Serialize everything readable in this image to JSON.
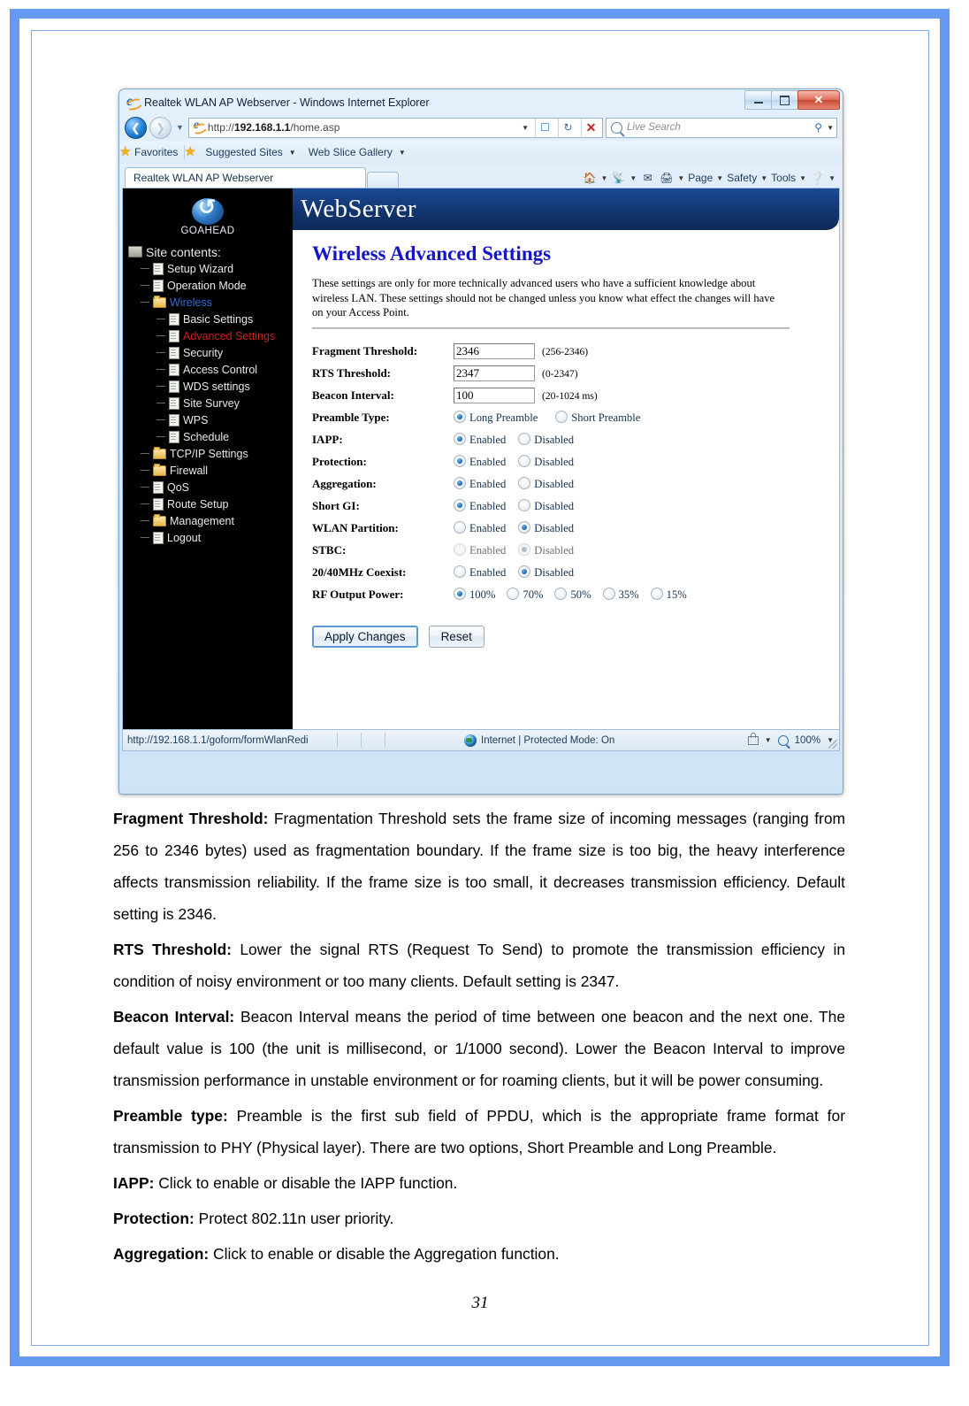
{
  "browser": {
    "window_title": "Realtek WLAN AP Webserver - Windows Internet Explorer",
    "window_buttons": {
      "minimize": "minimize-button",
      "maximize": "maximize-button",
      "close": "✕"
    },
    "address": {
      "url_prefix": "http://",
      "url_host": "192.168.1.1",
      "url_path": "/home.asp"
    },
    "search_placeholder": "Live Search",
    "favorites_label": "Favorites",
    "suggested_sites_label": "Suggested Sites",
    "web_slice_label": "Web Slice Gallery",
    "tab_label": "Realtek WLAN AP Webserver",
    "command_bar": [
      "Page",
      "Safety",
      "Tools"
    ],
    "status": {
      "url": "http://192.168.1.1/goform/formWlanRedi",
      "zone": "Internet | Protected Mode: On",
      "zoom": "100%"
    }
  },
  "webapp": {
    "brand": "GOAHEAD",
    "banner_title": "WebServer",
    "sidebar": {
      "root_label": "Site contents:",
      "items": [
        {
          "label": "Setup Wizard",
          "icon": "doc-icon",
          "level": 1,
          "state": "normal"
        },
        {
          "label": "Operation Mode",
          "icon": "doc-icon",
          "level": 1,
          "state": "normal"
        },
        {
          "label": "Wireless",
          "icon": "folder-icon",
          "level": 1,
          "state": "open"
        },
        {
          "label": "Basic Settings",
          "icon": "doc-icon",
          "level": 2,
          "state": "normal"
        },
        {
          "label": "Advanced Settings",
          "icon": "doc-icon",
          "level": 2,
          "state": "selected"
        },
        {
          "label": "Security",
          "icon": "doc-icon",
          "level": 2,
          "state": "normal"
        },
        {
          "label": "Access Control",
          "icon": "doc-icon",
          "level": 2,
          "state": "normal"
        },
        {
          "label": "WDS settings",
          "icon": "doc-icon",
          "level": 2,
          "state": "normal"
        },
        {
          "label": "Site Survey",
          "icon": "doc-icon",
          "level": 2,
          "state": "normal"
        },
        {
          "label": "WPS",
          "icon": "doc-icon",
          "level": 2,
          "state": "normal"
        },
        {
          "label": "Schedule",
          "icon": "doc-icon",
          "level": 2,
          "state": "normal"
        },
        {
          "label": "TCP/IP Settings",
          "icon": "folder-icon",
          "level": 1,
          "state": "normal"
        },
        {
          "label": "Firewall",
          "icon": "folder-icon",
          "level": 1,
          "state": "normal"
        },
        {
          "label": "QoS",
          "icon": "doc-icon",
          "level": 1,
          "state": "normal"
        },
        {
          "label": "Route Setup",
          "icon": "doc-icon",
          "level": 1,
          "state": "normal"
        },
        {
          "label": "Management",
          "icon": "folder-icon",
          "level": 1,
          "state": "normal"
        },
        {
          "label": "Logout",
          "icon": "doc-icon",
          "level": 1,
          "state": "normal"
        }
      ]
    },
    "page_title": "Wireless Advanced Settings",
    "page_description": "These settings are only for more technically advanced users who have a sufficient knowledge about wireless LAN. These settings should not be changed unless you know what effect the changes will have on your Access Point.",
    "fields": {
      "fragment_threshold": {
        "label": "Fragment Threshold:",
        "value": "2346",
        "hint": "(256-2346)"
      },
      "rts_threshold": {
        "label": "RTS Threshold:",
        "value": "2347",
        "hint": "(0-2347)"
      },
      "beacon_interval": {
        "label": "Beacon Interval:",
        "value": "100",
        "hint": "(20-1024 ms)"
      },
      "preamble_type": {
        "label": "Preamble Type:",
        "options": [
          "Long Preamble",
          "Short Preamble"
        ],
        "selected": "Long Preamble"
      },
      "iapp": {
        "label": "IAPP:",
        "options": [
          "Enabled",
          "Disabled"
        ],
        "selected": "Enabled"
      },
      "protection": {
        "label": "Protection:",
        "options": [
          "Enabled",
          "Disabled"
        ],
        "selected": "Enabled"
      },
      "aggregation": {
        "label": "Aggregation:",
        "options": [
          "Enabled",
          "Disabled"
        ],
        "selected": "Enabled"
      },
      "short_gi": {
        "label": "Short GI:",
        "options": [
          "Enabled",
          "Disabled"
        ],
        "selected": "Enabled"
      },
      "wlan_partition": {
        "label": "WLAN Partition:",
        "options": [
          "Enabled",
          "Disabled"
        ],
        "selected": "Disabled"
      },
      "stbc": {
        "label": "STBC:",
        "options": [
          "Enabled",
          "Disabled"
        ],
        "selected": "Disabled",
        "disabled": true
      },
      "coexist": {
        "label": "20/40MHz Coexist:",
        "options": [
          "Enabled",
          "Disabled"
        ],
        "selected": "Disabled"
      },
      "rf_output_power": {
        "label": "RF Output Power:",
        "options": [
          "100%",
          "70%",
          "50%",
          "35%",
          "15%"
        ],
        "selected": "100%"
      }
    },
    "buttons": {
      "apply": "Apply Changes",
      "reset": "Reset"
    }
  },
  "manual": {
    "paragraphs": [
      {
        "term": "Fragment Threshold:",
        "text": " Fragmentation Threshold sets the frame size of incoming messages (ranging from 256 to 2346 bytes) used as fragmentation boundary. If the frame size is too big, the heavy interference affects transmission reliability. If the frame size is too small, it decreases transmission efficiency. Default setting is 2346."
      },
      {
        "term": "RTS Threshold:",
        "text": " Lower the signal RTS (Request To Send) to promote the transmission efficiency in condition of noisy environment or too many clients. Default setting is 2347."
      },
      {
        "term": "Beacon Interval:",
        "text": " Beacon Interval means the period of time between one beacon and the next one. The default value is 100 (the unit is millisecond, or 1/1000 second). Lower the Beacon Interval to improve transmission performance in unstable environment or for roaming clients, but it will be power consuming."
      },
      {
        "term": "Preamble type:",
        "text": " Preamble is the first sub field of PPDU, which is the appropriate frame format for transmission to PHY (Physical layer). There are two options, Short Preamble and Long Preamble."
      },
      {
        "term": "IAPP:",
        "text": " Click to enable or disable the IAPP function."
      },
      {
        "term": "Protection:",
        "text": " Protect 802.11n user priority."
      },
      {
        "term": "Aggregation:",
        "text": " Click to enable or disable the Aggregation function."
      }
    ],
    "page_number": "31"
  }
}
